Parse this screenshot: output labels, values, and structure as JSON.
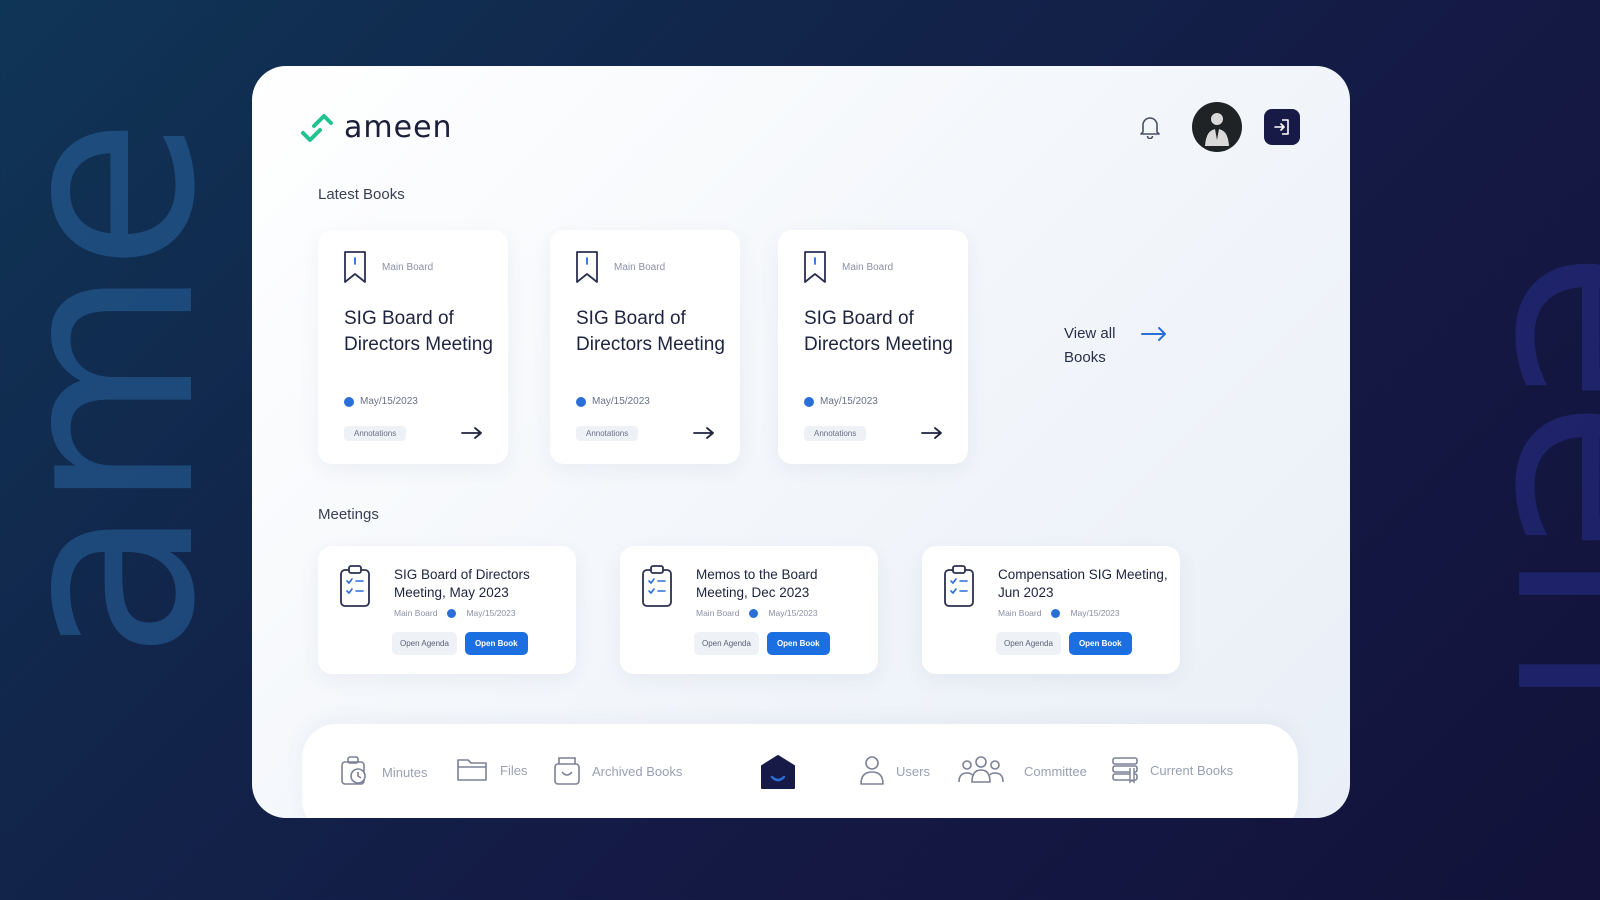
{
  "background": {
    "left_word": "ame",
    "right_word": "een"
  },
  "brand": {
    "name": "ameen",
    "accent": "#22c38e"
  },
  "header": {
    "bell_icon": "bell-icon",
    "avatar_icon": "user-avatar",
    "logout_icon": "logout-icon"
  },
  "latest_books": {
    "title": "Latest Books",
    "items": [
      {
        "board": "Main Board",
        "title": "SIG Board of Directors Meeting",
        "date": "May/15/2023",
        "tag": "Annotations"
      },
      {
        "board": "Main Board",
        "title": "SIG Board of Directors Meeting",
        "date": "May/15/2023",
        "tag": "Annotations"
      },
      {
        "board": "Main Board",
        "title": "SIG Board of Directors Meeting",
        "date": "May/15/2023",
        "tag": "Annotations"
      }
    ],
    "view_all": "View all Books"
  },
  "meetings": {
    "title": "Meetings",
    "items": [
      {
        "title": "SIG Board of Directors Meeting, May 2023",
        "board": "Main Board",
        "date": "May/15/2023",
        "agenda_label": "Open Agenda",
        "book_label": "Open Book"
      },
      {
        "title": "Memos to the Board Meeting, Dec 2023",
        "board": "Main Board",
        "date": "May/15/2023",
        "agenda_label": "Open Agenda",
        "book_label": "Open Book"
      },
      {
        "title": "Compensation SIG Meeting, Jun 2023",
        "board": "Main Board",
        "date": "May/15/2023",
        "agenda_label": "Open Agenda",
        "book_label": "Open Book"
      }
    ]
  },
  "nav": {
    "minutes": "Minutes",
    "files": "Files",
    "archived": "Archived Books",
    "users": "Users",
    "committee": "Committee",
    "current": "Current Books"
  },
  "colors": {
    "primary": "#1c6fe0",
    "navy": "#171a47",
    "text": "#1e2340"
  }
}
